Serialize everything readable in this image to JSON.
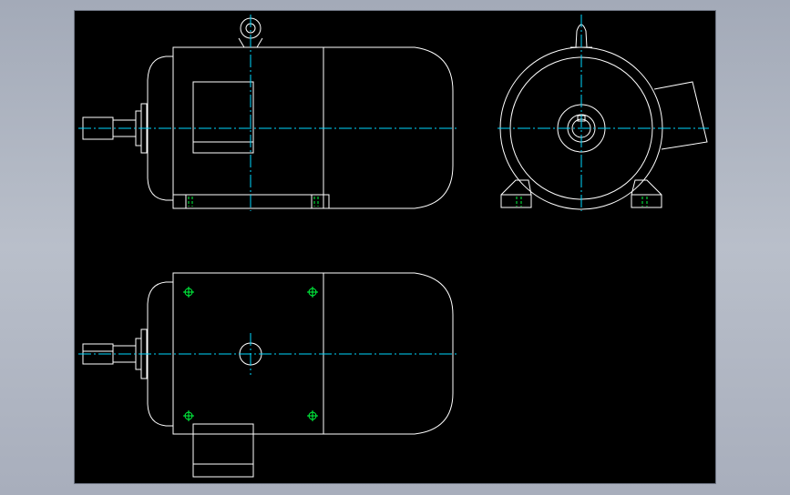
{
  "colors": {
    "background": "#a8aebc",
    "viewport": "#000000",
    "outline": "#ffffff",
    "centerline": "#00d8ff",
    "hole_marker": "#00ff40"
  },
  "views": [
    {
      "id": "front-view",
      "kind": "side elevation"
    },
    {
      "id": "end-view",
      "kind": "end elevation"
    },
    {
      "id": "top-view",
      "kind": "plan"
    }
  ]
}
